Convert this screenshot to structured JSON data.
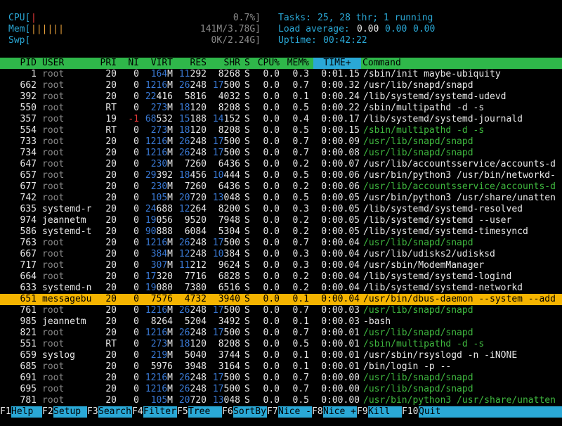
{
  "meters": {
    "cpu_label": "CPU[",
    "cpu_bar": "|",
    "cpu_value": "0.7%]",
    "mem_label": "Mem[",
    "mem_bar": "||||||",
    "mem_value": "141M/3.78G]",
    "swp_label": "Swp[",
    "swp_bar": "",
    "swp_value": "0K/2.24G]"
  },
  "summary": {
    "tasks_label": "Tasks:",
    "tasks_value": "25, 28 thr; 1 running",
    "load_label": "Load average:",
    "load_1": "0.00",
    "load_5": "0.00",
    "load_15": "0.00",
    "uptime_label": "Uptime:",
    "uptime_value": "00:42:22"
  },
  "columns": [
    "PID",
    "USER",
    "PRI",
    "NI",
    "VIRT",
    "RES",
    "SHR",
    "S",
    "CPU%",
    "MEM%",
    "TIME+",
    "Command"
  ],
  "processes": [
    {
      "pid": "1",
      "user": "root",
      "pri": "20",
      "ni": "0",
      "virt": "164M",
      "res": "11292",
      "shr": "8268",
      "s": "S",
      "cpu": "0.0",
      "mem": "0.3",
      "time": "0:01.15",
      "cmd": "/sbin/init maybe-ubiquity",
      "thread": false
    },
    {
      "pid": "662",
      "user": "root",
      "pri": "20",
      "ni": "0",
      "virt": "1216M",
      "res": "26248",
      "shr": "17500",
      "s": "S",
      "cpu": "0.0",
      "mem": "0.7",
      "time": "0:00.32",
      "cmd": "/usr/lib/snapd/snapd",
      "thread": false
    },
    {
      "pid": "392",
      "user": "root",
      "pri": "20",
      "ni": "0",
      "virt": "22416",
      "res": "5816",
      "shr": "4032",
      "s": "S",
      "cpu": "0.0",
      "mem": "0.1",
      "time": "0:00.24",
      "cmd": "/lib/systemd/systemd-udevd",
      "thread": false
    },
    {
      "pid": "550",
      "user": "root",
      "pri": "RT",
      "ni": "0",
      "virt": "273M",
      "res": "18120",
      "shr": "8208",
      "s": "S",
      "cpu": "0.0",
      "mem": "0.5",
      "time": "0:00.22",
      "cmd": "/sbin/multipathd -d -s",
      "thread": false
    },
    {
      "pid": "357",
      "user": "root",
      "pri": "19",
      "ni": "-1",
      "virt": "68532",
      "res": "15188",
      "shr": "14152",
      "s": "S",
      "cpu": "0.0",
      "mem": "0.4",
      "time": "0:00.17",
      "cmd": "/lib/systemd/systemd-journald",
      "thread": false
    },
    {
      "pid": "554",
      "user": "root",
      "pri": "RT",
      "ni": "0",
      "virt": "273M",
      "res": "18120",
      "shr": "8208",
      "s": "S",
      "cpu": "0.0",
      "mem": "0.5",
      "time": "0:00.15",
      "cmd": "/sbin/multipathd -d -s",
      "thread": true
    },
    {
      "pid": "733",
      "user": "root",
      "pri": "20",
      "ni": "0",
      "virt": "1216M",
      "res": "26248",
      "shr": "17500",
      "s": "S",
      "cpu": "0.0",
      "mem": "0.7",
      "time": "0:00.09",
      "cmd": "/usr/lib/snapd/snapd",
      "thread": true
    },
    {
      "pid": "734",
      "user": "root",
      "pri": "20",
      "ni": "0",
      "virt": "1216M",
      "res": "26248",
      "shr": "17500",
      "s": "S",
      "cpu": "0.0",
      "mem": "0.7",
      "time": "0:00.08",
      "cmd": "/usr/lib/snapd/snapd",
      "thread": true
    },
    {
      "pid": "647",
      "user": "root",
      "pri": "20",
      "ni": "0",
      "virt": "230M",
      "res": "7260",
      "shr": "6436",
      "s": "S",
      "cpu": "0.0",
      "mem": "0.2",
      "time": "0:00.07",
      "cmd": "/usr/lib/accountsservice/accounts-d",
      "thread": false
    },
    {
      "pid": "657",
      "user": "root",
      "pri": "20",
      "ni": "0",
      "virt": "29392",
      "res": "18456",
      "shr": "10444",
      "s": "S",
      "cpu": "0.0",
      "mem": "0.5",
      "time": "0:00.06",
      "cmd": "/usr/bin/python3 /usr/bin/networkd-",
      "thread": false
    },
    {
      "pid": "677",
      "user": "root",
      "pri": "20",
      "ni": "0",
      "virt": "230M",
      "res": "7260",
      "shr": "6436",
      "s": "S",
      "cpu": "0.0",
      "mem": "0.2",
      "time": "0:00.06",
      "cmd": "/usr/lib/accountsservice/accounts-d",
      "thread": true
    },
    {
      "pid": "742",
      "user": "root",
      "pri": "20",
      "ni": "0",
      "virt": "105M",
      "res": "20720",
      "shr": "13048",
      "s": "S",
      "cpu": "0.0",
      "mem": "0.5",
      "time": "0:00.05",
      "cmd": "/usr/bin/python3 /usr/share/unatten",
      "thread": false
    },
    {
      "pid": "635",
      "user": "systemd-r",
      "pri": "20",
      "ni": "0",
      "virt": "24688",
      "res": "12264",
      "shr": "8200",
      "s": "S",
      "cpu": "0.0",
      "mem": "0.3",
      "time": "0:00.05",
      "cmd": "/lib/systemd/systemd-resolved",
      "thread": false
    },
    {
      "pid": "974",
      "user": "jeannetm",
      "pri": "20",
      "ni": "0",
      "virt": "19056",
      "res": "9520",
      "shr": "7948",
      "s": "S",
      "cpu": "0.0",
      "mem": "0.2",
      "time": "0:00.05",
      "cmd": "/lib/systemd/systemd --user",
      "thread": false
    },
    {
      "pid": "586",
      "user": "systemd-t",
      "pri": "20",
      "ni": "0",
      "virt": "90888",
      "res": "6084",
      "shr": "5304",
      "s": "S",
      "cpu": "0.0",
      "mem": "0.2",
      "time": "0:00.05",
      "cmd": "/lib/systemd/systemd-timesyncd",
      "thread": false
    },
    {
      "pid": "763",
      "user": "root",
      "pri": "20",
      "ni": "0",
      "virt": "1216M",
      "res": "26248",
      "shr": "17500",
      "s": "S",
      "cpu": "0.0",
      "mem": "0.7",
      "time": "0:00.04",
      "cmd": "/usr/lib/snapd/snapd",
      "thread": true
    },
    {
      "pid": "667",
      "user": "root",
      "pri": "20",
      "ni": "0",
      "virt": "384M",
      "res": "12248",
      "shr": "10384",
      "s": "S",
      "cpu": "0.0",
      "mem": "0.3",
      "time": "0:00.04",
      "cmd": "/usr/lib/udisks2/udisksd",
      "thread": false
    },
    {
      "pid": "717",
      "user": "root",
      "pri": "20",
      "ni": "0",
      "virt": "307M",
      "res": "11212",
      "shr": "9624",
      "s": "S",
      "cpu": "0.0",
      "mem": "0.3",
      "time": "0:00.04",
      "cmd": "/usr/sbin/ModemManager",
      "thread": false
    },
    {
      "pid": "664",
      "user": "root",
      "pri": "20",
      "ni": "0",
      "virt": "17320",
      "res": "7716",
      "shr": "6828",
      "s": "S",
      "cpu": "0.0",
      "mem": "0.2",
      "time": "0:00.04",
      "cmd": "/lib/systemd/systemd-logind",
      "thread": false
    },
    {
      "pid": "633",
      "user": "systemd-n",
      "pri": "20",
      "ni": "0",
      "virt": "19080",
      "res": "7380",
      "shr": "6516",
      "s": "S",
      "cpu": "0.0",
      "mem": "0.2",
      "time": "0:00.04",
      "cmd": "/lib/systemd/systemd-networkd",
      "thread": false
    },
    {
      "pid": "651",
      "user": "messagebu",
      "pri": "20",
      "ni": "0",
      "virt": "7576",
      "res": "4732",
      "shr": "3940",
      "s": "S",
      "cpu": "0.0",
      "mem": "0.1",
      "time": "0:00.04",
      "cmd": "/usr/bin/dbus-daemon --system --add",
      "thread": false,
      "selected": true
    },
    {
      "pid": "761",
      "user": "root",
      "pri": "20",
      "ni": "0",
      "virt": "1216M",
      "res": "26248",
      "shr": "17500",
      "s": "S",
      "cpu": "0.0",
      "mem": "0.7",
      "time": "0:00.03",
      "cmd": "/usr/lib/snapd/snapd",
      "thread": true
    },
    {
      "pid": "985",
      "user": "jeannetm",
      "pri": "20",
      "ni": "0",
      "virt": "8264",
      "res": "5204",
      "shr": "3492",
      "s": "S",
      "cpu": "0.0",
      "mem": "0.1",
      "time": "0:00.03",
      "cmd": "-bash",
      "thread": false
    },
    {
      "pid": "821",
      "user": "root",
      "pri": "20",
      "ni": "0",
      "virt": "1216M",
      "res": "26248",
      "shr": "17500",
      "s": "S",
      "cpu": "0.0",
      "mem": "0.7",
      "time": "0:00.01",
      "cmd": "/usr/lib/snapd/snapd",
      "thread": true
    },
    {
      "pid": "551",
      "user": "root",
      "pri": "RT",
      "ni": "0",
      "virt": "273M",
      "res": "18120",
      "shr": "8208",
      "s": "S",
      "cpu": "0.0",
      "mem": "0.5",
      "time": "0:00.01",
      "cmd": "/sbin/multipathd -d -s",
      "thread": true
    },
    {
      "pid": "659",
      "user": "syslog",
      "pri": "20",
      "ni": "0",
      "virt": "219M",
      "res": "5040",
      "shr": "3744",
      "s": "S",
      "cpu": "0.0",
      "mem": "0.1",
      "time": "0:00.01",
      "cmd": "/usr/sbin/rsyslogd -n -iNONE",
      "thread": false
    },
    {
      "pid": "685",
      "user": "root",
      "pri": "20",
      "ni": "0",
      "virt": "5976",
      "res": "3948",
      "shr": "3164",
      "s": "S",
      "cpu": "0.0",
      "mem": "0.1",
      "time": "0:00.01",
      "cmd": "/bin/login -p --",
      "thread": false
    },
    {
      "pid": "691",
      "user": "root",
      "pri": "20",
      "ni": "0",
      "virt": "1216M",
      "res": "26248",
      "shr": "17500",
      "s": "S",
      "cpu": "0.0",
      "mem": "0.7",
      "time": "0:00.00",
      "cmd": "/usr/lib/snapd/snapd",
      "thread": true
    },
    {
      "pid": "695",
      "user": "root",
      "pri": "20",
      "ni": "0",
      "virt": "1216M",
      "res": "26248",
      "shr": "17500",
      "s": "S",
      "cpu": "0.0",
      "mem": "0.7",
      "time": "0:00.00",
      "cmd": "/usr/lib/snapd/snapd",
      "thread": true
    },
    {
      "pid": "781",
      "user": "root",
      "pri": "20",
      "ni": "0",
      "virt": "105M",
      "res": "20720",
      "shr": "13048",
      "s": "S",
      "cpu": "0.0",
      "mem": "0.5",
      "time": "0:00.00",
      "cmd": "/usr/bin/python3 /usr/share/unatten",
      "thread": true
    }
  ],
  "footer": [
    {
      "key": "F1",
      "label": "Help"
    },
    {
      "key": "F2",
      "label": "Setup"
    },
    {
      "key": "F3",
      "label": "Search"
    },
    {
      "key": "F4",
      "label": "Filter"
    },
    {
      "key": "F5",
      "label": "Tree"
    },
    {
      "key": "F6",
      "label": "SortBy"
    },
    {
      "key": "F7",
      "label": "Nice -"
    },
    {
      "key": "F8",
      "label": "Nice +"
    },
    {
      "key": "F9",
      "label": "Kill"
    },
    {
      "key": "F10",
      "label": "Quit"
    }
  ],
  "colors": {
    "header_bg": "#2fb74a",
    "sorted_col_bg": "#2aa8d6",
    "selected_row_bg": "#f5b400",
    "accent_cyan": "#2aa8d6",
    "thread_green": "#3fb83f",
    "large_value_blue": "#3a7ad6"
  }
}
